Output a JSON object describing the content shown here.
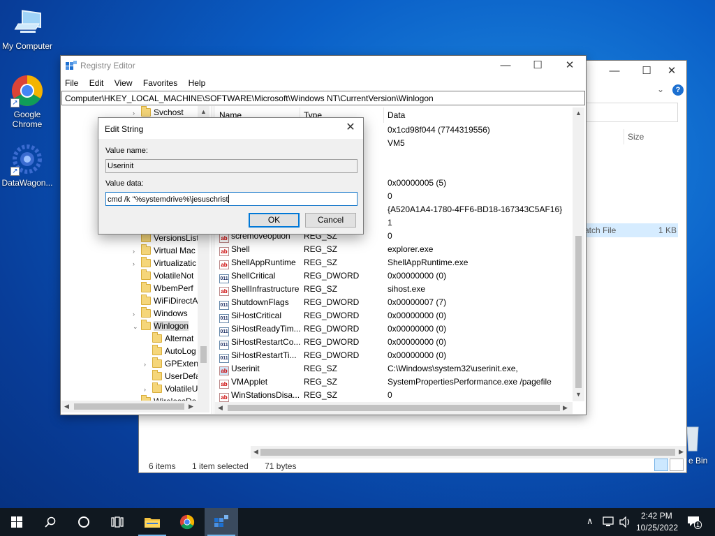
{
  "desktop": {
    "icons": [
      {
        "label": "My Computer",
        "icon": "computer-icon"
      },
      {
        "label": "Google Chrome",
        "icon": "chrome-icon"
      },
      {
        "label": "DataWagon...",
        "icon": "datawagon-icon"
      }
    ],
    "recycle_bin_partial": "e Bin"
  },
  "explorer": {
    "column_size": "Size",
    "selected_file_type": "atch File",
    "selected_file_size": "1 KB",
    "status_items": "6 items",
    "status_selected": "1 item selected",
    "status_size": "71 bytes"
  },
  "regedit": {
    "title": "Registry Editor",
    "menu": [
      "File",
      "Edit",
      "View",
      "Favorites",
      "Help"
    ],
    "address": "Computer\\HKEY_LOCAL_MACHINE\\SOFTWARE\\Microsoft\\Windows NT\\CurrentVersion\\Winlogon",
    "tree": [
      {
        "label": "Svchost",
        "level": 0,
        "expander": "›"
      },
      {
        "label": "VersionsList",
        "level": 0,
        "expander": ""
      },
      {
        "label": "Virtual Mac",
        "level": 0,
        "expander": "›"
      },
      {
        "label": "Virtualizatic",
        "level": 0,
        "expander": "›"
      },
      {
        "label": "VolatileNot",
        "level": 0,
        "expander": ""
      },
      {
        "label": "WbemPerf",
        "level": 0,
        "expander": ""
      },
      {
        "label": "WiFiDirectA",
        "level": 0,
        "expander": ""
      },
      {
        "label": "Windows",
        "level": 0,
        "expander": "›"
      },
      {
        "label": "Winlogon",
        "level": 0,
        "expander": "⌄",
        "selected": true
      },
      {
        "label": "Alternat",
        "level": 1,
        "expander": ""
      },
      {
        "label": "AutoLog",
        "level": 1,
        "expander": ""
      },
      {
        "label": "GPExten",
        "level": 1,
        "expander": "›"
      },
      {
        "label": "UserDefa",
        "level": 1,
        "expander": ""
      },
      {
        "label": "VolatileU",
        "level": 1,
        "expander": "›"
      },
      {
        "label": "WirelessDo",
        "level": 0,
        "expander": ""
      }
    ],
    "columns": {
      "name": "Name",
      "type": "Type",
      "data": "Data"
    },
    "values_behind_dialog": [
      {
        "data": "0x1cd98f044 (7744319556)"
      },
      {
        "data": "VM5"
      },
      {
        "data": ""
      },
      {
        "data": ""
      },
      {
        "data": "0x00000005 (5)"
      },
      {
        "data": "0"
      },
      {
        "data": "{A520A1A4-1780-4FF6-BD18-167343C5AF16}"
      },
      {
        "data": "1"
      }
    ],
    "values": [
      {
        "name": "scremoveoption",
        "type": "REG_SZ",
        "data": "0",
        "kind": "sz"
      },
      {
        "name": "Shell",
        "type": "REG_SZ",
        "data": "explorer.exe",
        "kind": "sz"
      },
      {
        "name": "ShellAppRuntime",
        "type": "REG_SZ",
        "data": "ShellAppRuntime.exe",
        "kind": "sz"
      },
      {
        "name": "ShellCritical",
        "type": "REG_DWORD",
        "data": "0x00000000 (0)",
        "kind": "dw"
      },
      {
        "name": "ShellInfrastructure",
        "type": "REG_SZ",
        "data": "sihost.exe",
        "kind": "sz"
      },
      {
        "name": "ShutdownFlags",
        "type": "REG_DWORD",
        "data": "0x00000007 (7)",
        "kind": "dw"
      },
      {
        "name": "SiHostCritical",
        "type": "REG_DWORD",
        "data": "0x00000000 (0)",
        "kind": "dw"
      },
      {
        "name": "SiHostReadyTim...",
        "type": "REG_DWORD",
        "data": "0x00000000 (0)",
        "kind": "dw"
      },
      {
        "name": "SiHostRestartCo...",
        "type": "REG_DWORD",
        "data": "0x00000000 (0)",
        "kind": "dw"
      },
      {
        "name": "SiHostRestartTi...",
        "type": "REG_DWORD",
        "data": "0x00000000 (0)",
        "kind": "dw"
      },
      {
        "name": "Userinit",
        "type": "REG_SZ",
        "data": "C:\\Windows\\system32\\userinit.exe,",
        "kind": "sz",
        "selected": true
      },
      {
        "name": "VMApplet",
        "type": "REG_SZ",
        "data": "SystemPropertiesPerformance.exe /pagefile",
        "kind": "sz"
      },
      {
        "name": "WinStationsDisa...",
        "type": "REG_SZ",
        "data": "0",
        "kind": "sz"
      }
    ]
  },
  "dialog": {
    "title": "Edit String",
    "value_name_label": "Value name:",
    "value_name": "Userinit",
    "value_data_label": "Value data:",
    "value_data": "cmd /k \"%systemdrive%\\jesuschrist",
    "ok_label": "OK",
    "cancel_label": "Cancel"
  },
  "taskbar": {
    "time": "2:42 PM",
    "date": "10/25/2022",
    "notification_count": "1"
  },
  "colors": {
    "accent": "#0078d7",
    "taskbar": "#101820"
  }
}
